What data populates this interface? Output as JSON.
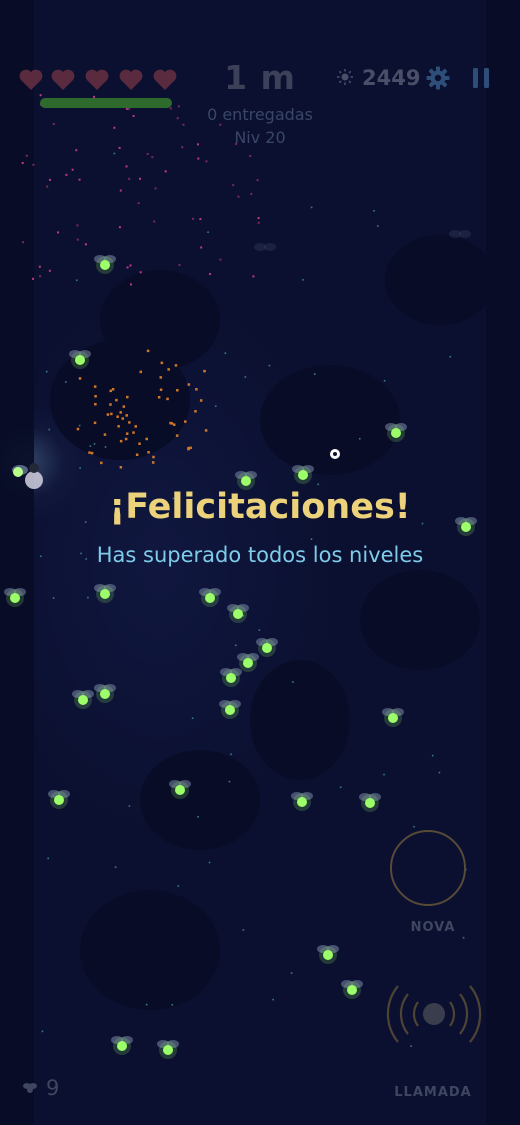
{
  "hud": {
    "lives": 5,
    "heart_color": "#5a2a3e",
    "distance": "1 m",
    "delivered": "0 entregadas",
    "level": "Niv 20",
    "score": "2449",
    "energy_level": 1.0,
    "icons": [
      "heart-icon",
      "sun-icon",
      "gear-icon",
      "pause-icon"
    ]
  },
  "message": {
    "title": "¡Felicitaciones!",
    "subtitle": "Has superado todos los niveles",
    "title_color": "#ecd27a",
    "subtitle_color": "#7ecbea"
  },
  "controls": {
    "nova_label": "NOVA",
    "call_label": "LLAMADA",
    "ring_color": "#574a38"
  },
  "footer": {
    "firefly_count": "9"
  },
  "colors": {
    "background": "#0b1030",
    "firefly_glow": "#9cff6a"
  }
}
